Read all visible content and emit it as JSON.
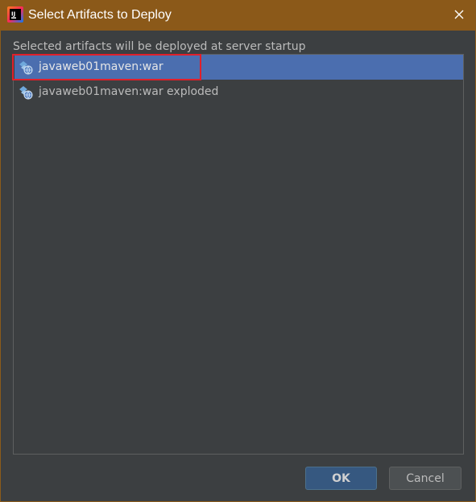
{
  "window": {
    "title": "Select Artifacts to Deploy",
    "app_icon": "intellij-idea-icon",
    "close_icon": "close-icon"
  },
  "dialog": {
    "description": "Selected artifacts will be deployed at server startup",
    "artifacts": [
      {
        "label": "javaweb01maven:war",
        "icon": "web-artifact-icon",
        "selected": true,
        "highlighted": true
      },
      {
        "label": "javaweb01maven:war exploded",
        "icon": "web-artifact-icon",
        "selected": false,
        "highlighted": false
      }
    ]
  },
  "buttons": {
    "ok_label": "OK",
    "cancel_label": "Cancel"
  },
  "colors": {
    "titlebar": "#8b5919",
    "panel_background": "#3c3f41",
    "selection": "#4b6eaf",
    "highlight_border": "#e0202a",
    "ok_button": "#365880"
  }
}
